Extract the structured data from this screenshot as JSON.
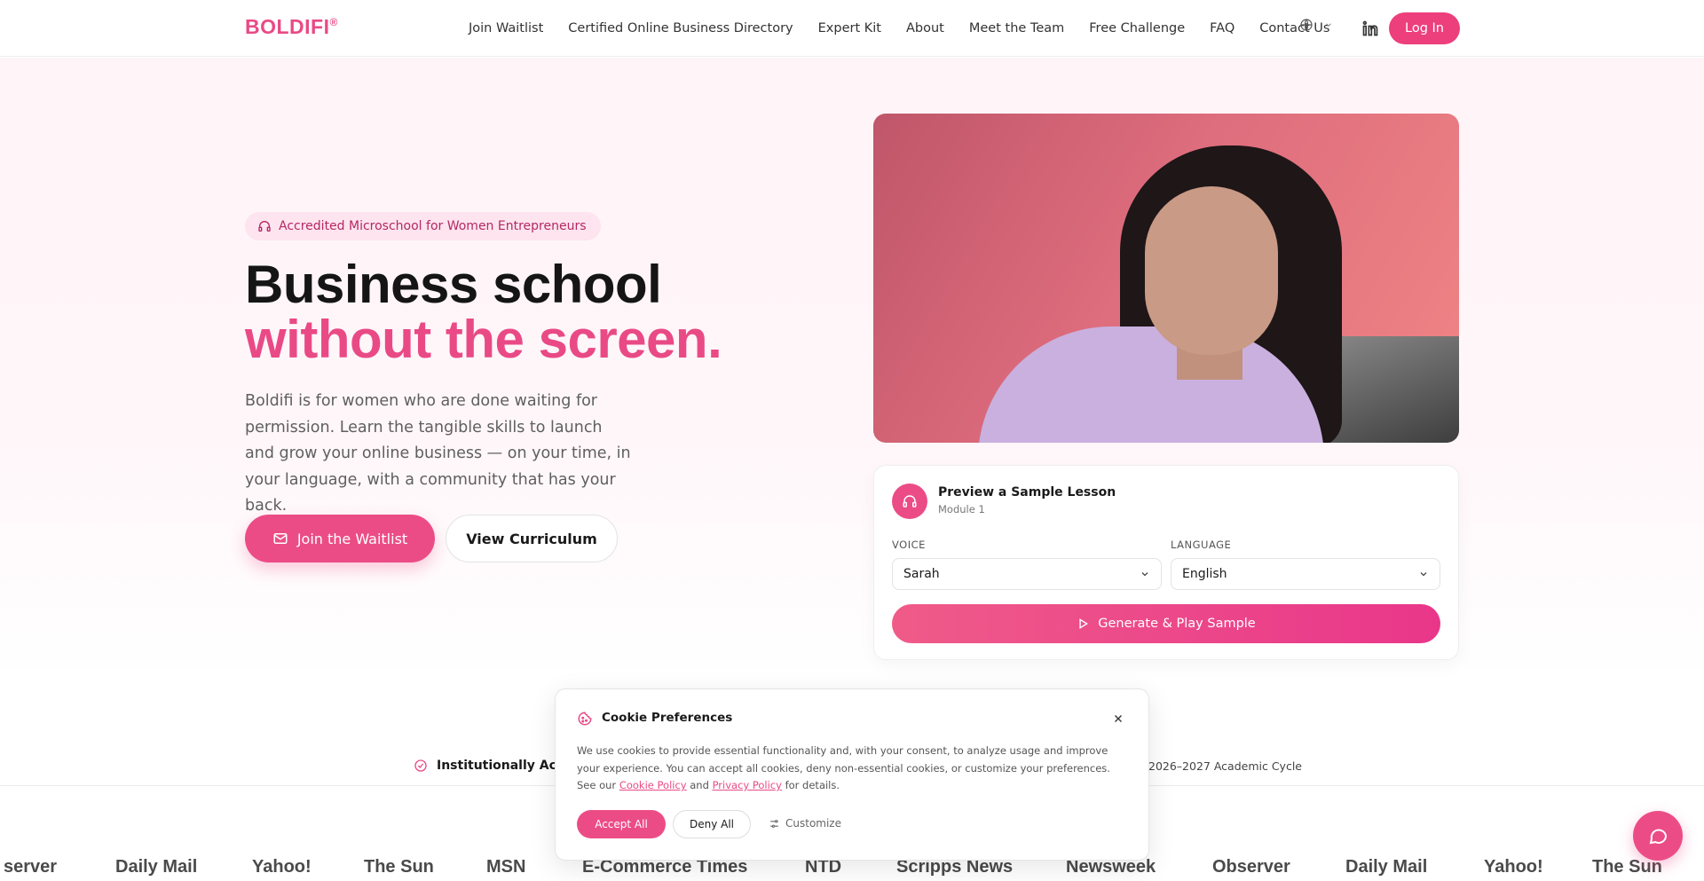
{
  "brand": {
    "logo": "BOLDIFI",
    "logo_mark": "®",
    "accent": "#e94a86"
  },
  "nav": {
    "links": [
      "Join Waitlist",
      "Certified Online Business Directory",
      "Expert Kit",
      "About",
      "Meet the Team",
      "Free Challenge",
      "FAQ",
      "Contact Us"
    ],
    "language_label": "",
    "login_label": "Log In"
  },
  "hero": {
    "badge": "Accredited Microschool for Women Entrepreneurs",
    "title_line1": "Business school",
    "title_line2": "without the screen.",
    "lead": "Boldifi is for women who are done waiting for permission. Learn the tangible skills to launch and grow your online business — on your time, in your language, with a community that has your back.",
    "primary_cta": "Join the Waitlist",
    "secondary_cta": "View Curriculum"
  },
  "lesson": {
    "title": "Preview a Sample Lesson",
    "subtitle": "Module 1",
    "voice_label": "VOICE",
    "voice_value": "Sarah",
    "language_label": "LANGUAGE",
    "language_value": "English",
    "generate_label": "Generate & Play Sample"
  },
  "accreditation": {
    "text": "Institutionally Accre",
    "cycle": "2026–2027 Academic Cycle"
  },
  "press": [
    "server",
    "Daily Mail",
    "Yahoo!",
    "The Sun",
    "MSN",
    "E-Commerce Times",
    "NTD",
    "Scripps News",
    "Newsweek",
    "Observer",
    "Daily Mail",
    "Yahoo!",
    "The Sun"
  ],
  "cookie": {
    "title": "Cookie Preferences",
    "body_prefix": "We use cookies to provide essential functionality and, with your consent, to analyze usage and improve your experience. You can accept all cookies, deny non-essential cookies, or customize your preferences. See our ",
    "cookie_policy": "Cookie Policy",
    "and": " and ",
    "privacy_policy": "Privacy Policy",
    "body_suffix": " for details.",
    "accept": "Accept All",
    "deny": "Deny All",
    "customize": "Customize"
  }
}
